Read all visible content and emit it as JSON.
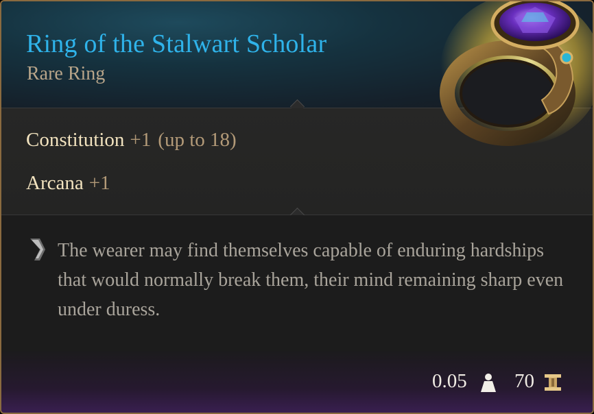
{
  "item": {
    "name": "Ring of the Stalwart Scholar",
    "rarity_type": "Rare Ring",
    "colors": {
      "name": "#2fb3ea",
      "rarity": "#b8a58a",
      "stat_name": "#f2e3bf",
      "stat_value": "#b39a78"
    }
  },
  "stats": [
    {
      "name": "Constitution",
      "value": "+1",
      "cap": "(up to 18)"
    },
    {
      "name": "Arcana",
      "value": "+1"
    }
  ],
  "description": "The wearer may find themselves capable of enduring hardships that would normally break them, their mind remaining sharp even under duress.",
  "footer": {
    "weight": "0.05",
    "weight_icon": "weight-icon",
    "value": "70",
    "value_icon": "gold-coin-icon"
  }
}
